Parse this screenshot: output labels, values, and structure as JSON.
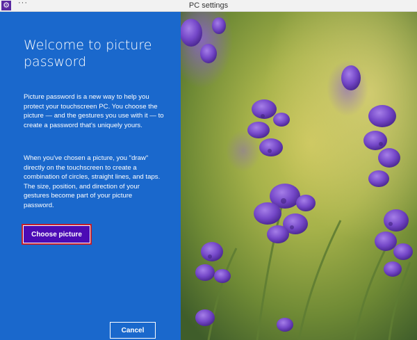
{
  "window": {
    "title": "PC settings",
    "menu_glyph": "···",
    "app_icon": "gear-icon"
  },
  "panel": {
    "heading": "Welcome to picture password",
    "paragraph1": "Picture password is a new way to help you protect your touchscreen PC. You choose the picture — and the gestures you use with it — to create a password that's uniquely yours.",
    "paragraph2": "When you've chosen a picture, you \"draw\" directly on the touchscreen to create a combination of circles, straight lines, and taps. The size, position, and direction of your gestures become part of your picture password.",
    "choose_picture_label": "Choose picture",
    "cancel_label": "Cancel"
  },
  "colors": {
    "panel_blue": "#1a68cc",
    "button_purple": "#4b0bb5",
    "focus_red": "#c41f2d",
    "lavender": "#7b4fd0",
    "foliage": "#8aa63a"
  }
}
